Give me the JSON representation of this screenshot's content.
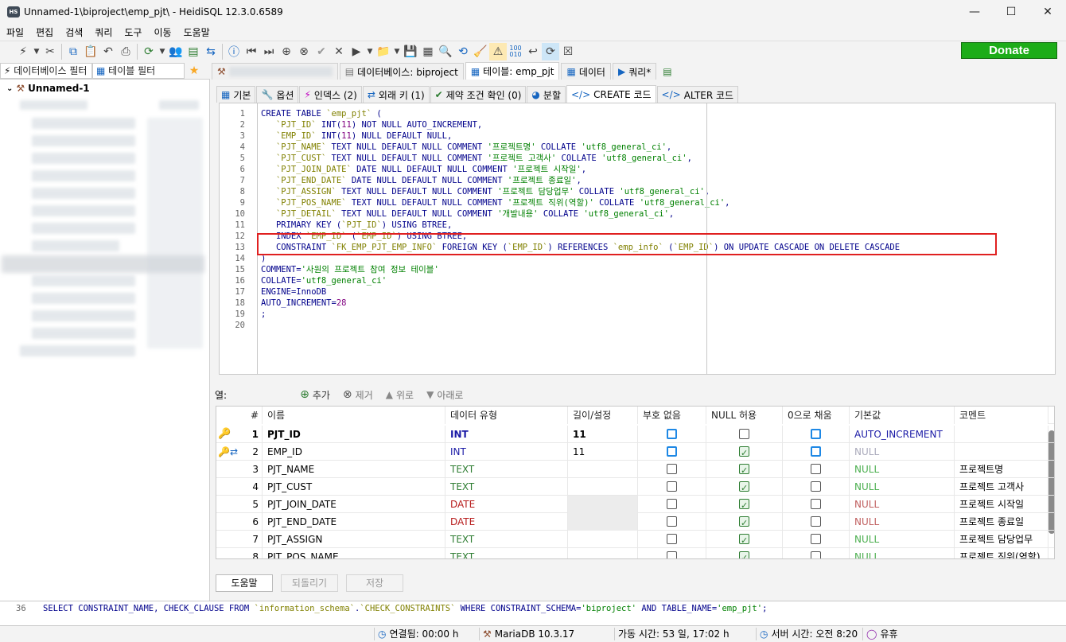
{
  "window": {
    "title": "Unnamed-1\\biproject\\emp_pjt\\ - HeidiSQL 12.3.0.6589",
    "app_icon": "HS"
  },
  "menu": [
    "파일",
    "편집",
    "검색",
    "쿼리",
    "도구",
    "이동",
    "도움말"
  ],
  "donate_label": "Donate",
  "left": {
    "db_filter": "데이터베이스 필터",
    "table_filter": "테이블 필터",
    "root": "Unnamed-1"
  },
  "tabs": [
    {
      "label": "데이터베이스: biproject",
      "icon": "database-icon"
    },
    {
      "label": "테이블: emp_pjt",
      "icon": "table-icon"
    },
    {
      "label": "데이터",
      "icon": "grid-icon"
    },
    {
      "label": "쿼리*",
      "icon": "play-icon"
    }
  ],
  "subtabs": [
    "기본",
    "옵션",
    "인덱스 (2)",
    "외래 키 (1)",
    "제약 조건 확인 (0)",
    "분할",
    "CREATE 코드",
    "ALTER 코드"
  ],
  "code_lines": [
    "CREATE TABLE `emp_pjt` (",
    "\t`PJT_ID` INT(11) NOT NULL AUTO_INCREMENT,",
    "\t`EMP_ID` INT(11) NULL DEFAULT NULL,",
    "\t`PJT_NAME` TEXT NULL DEFAULT NULL COMMENT '프로젝트명' COLLATE 'utf8_general_ci',",
    "\t`PJT_CUST` TEXT NULL DEFAULT NULL COMMENT '프로젝트 고객사' COLLATE 'utf8_general_ci',",
    "\t`PJT_JOIN_DATE` DATE NULL DEFAULT NULL COMMENT '프로젝트 시작일',",
    "\t`PJT_END_DATE` DATE NULL DEFAULT NULL COMMENT '프로젝트 종료일',",
    "\t`PJT_ASSIGN` TEXT NULL DEFAULT NULL COMMENT '프로젝트 담당업무' COLLATE 'utf8_general_ci',",
    "\t`PJT_POS_NAME` TEXT NULL DEFAULT NULL COMMENT '프로젝트 직위(역할)' COLLATE 'utf8_general_ci',",
    "\t`PJT_DETAIL` TEXT NULL DEFAULT NULL COMMENT '개발내용' COLLATE 'utf8_general_ci',",
    "\tPRIMARY KEY (`PJT_ID`) USING BTREE,",
    "\tINDEX `EMP_ID` (`EMP_ID`) USING BTREE,",
    "\tCONSTRAINT `FK_EMP_PJT_EMP_INFO` FOREIGN KEY (`EMP_ID`) REFERENCES `emp_info` (`EMP_ID`) ON UPDATE CASCADE ON DELETE CASCADE",
    ")",
    "COMMENT='사원의 프로젝트 참여 정보 테이블'",
    "COLLATE='utf8_general_ci'",
    "ENGINE=InnoDB",
    "AUTO_INCREMENT=28",
    ";",
    ""
  ],
  "columns_bar": {
    "label": "열:",
    "add": "추가",
    "remove": "제거",
    "up": "위로",
    "down": "아래로"
  },
  "grid": {
    "headers": [
      "#",
      "이름",
      "데이터 유형",
      "길이/설정",
      "부호 없음",
      "NULL 허용",
      "0으로 채움",
      "기본값",
      "코멘트"
    ],
    "rows": [
      {
        "n": "1",
        "name": "PJT_ID",
        "type": "INT",
        "len": "11",
        "def": "AUTO_INCREMENT",
        "comment": "",
        "bold": true
      },
      {
        "n": "2",
        "name": "EMP_ID",
        "type": "INT",
        "len": "11",
        "def": "NULL",
        "comment": ""
      },
      {
        "n": "3",
        "name": "PJT_NAME",
        "type": "TEXT",
        "len": "",
        "def": "NULL",
        "comment": "프로젝트명"
      },
      {
        "n": "4",
        "name": "PJT_CUST",
        "type": "TEXT",
        "len": "",
        "def": "NULL",
        "comment": "프로젝트 고객사"
      },
      {
        "n": "5",
        "name": "PJT_JOIN_DATE",
        "type": "DATE",
        "len": "",
        "def": "NULL",
        "comment": "프로젝트 시작일"
      },
      {
        "n": "6",
        "name": "PJT_END_DATE",
        "type": "DATE",
        "len": "",
        "def": "NULL",
        "comment": "프로젝트 종료일"
      },
      {
        "n": "7",
        "name": "PJT_ASSIGN",
        "type": "TEXT",
        "len": "",
        "def": "NULL",
        "comment": "프로젝트 담당업무"
      },
      {
        "n": "8",
        "name": "PJT_POS_NAME",
        "type": "TEXT",
        "len": "",
        "def": "NULL",
        "comment": "프로젝트 직위(역할)"
      }
    ]
  },
  "buttons": {
    "help": "도움말",
    "revert": "되돌리기",
    "save": "저장"
  },
  "log": {
    "line_no": "36",
    "sql": "SELECT CONSTRAINT_NAME, CHECK_CLAUSE FROM `information_schema`.`CHECK_CONSTRAINTS` WHERE CONSTRAINT_SCHEMA='biproject' AND TABLE_NAME='emp_pjt';"
  },
  "status": {
    "connected": "연결됨: 00:00 h",
    "server": "MariaDB 10.3.17",
    "uptime": "가동 시간: 53 일, 17:02 h",
    "server_time": "서버 시간: 오전 8:20",
    "idle": "유휴"
  }
}
